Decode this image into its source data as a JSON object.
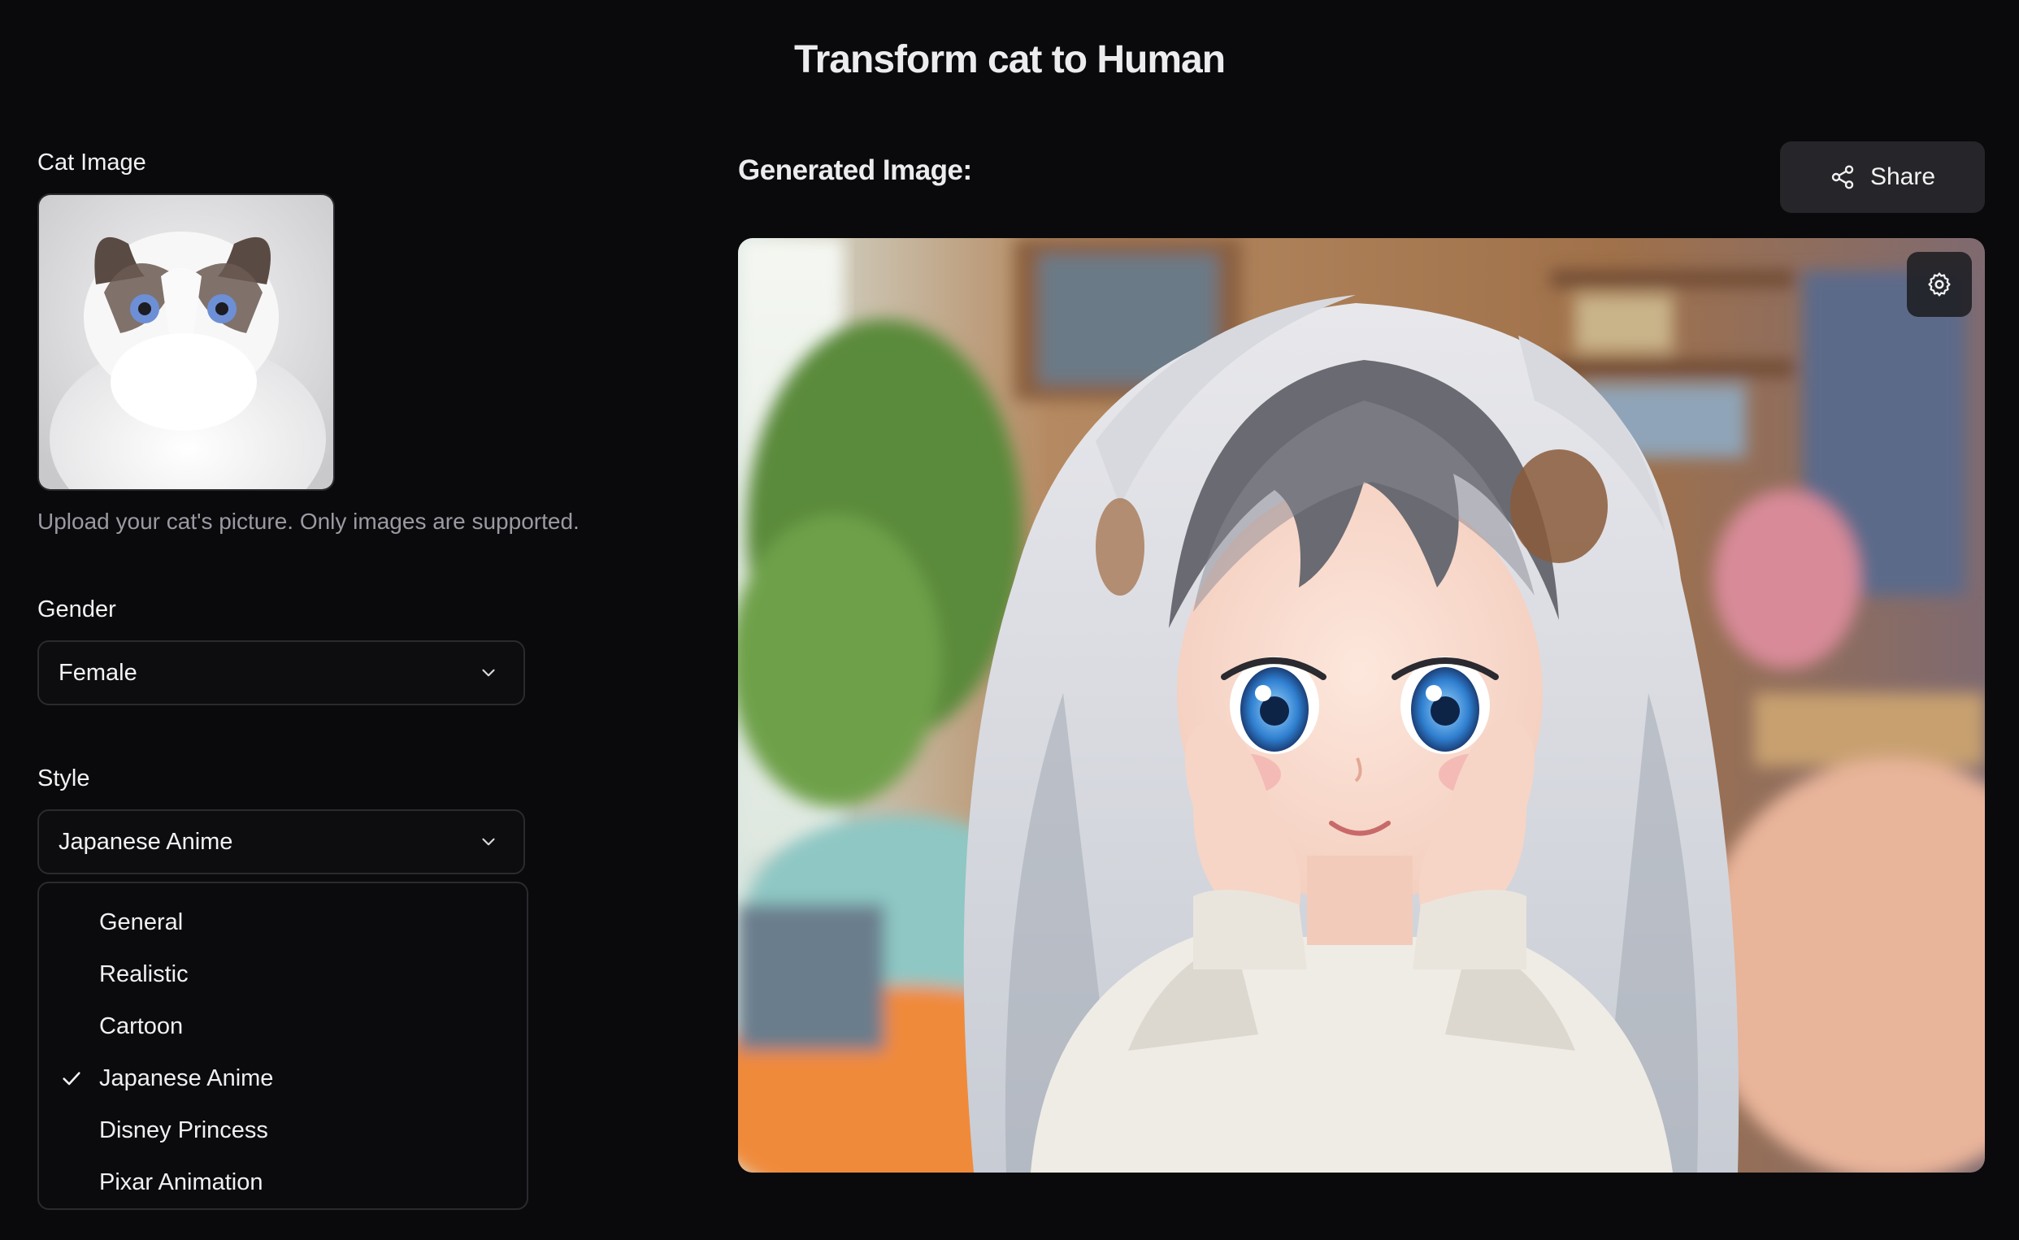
{
  "page_title": "Transform cat to Human",
  "cat_image": {
    "label": "Cat Image",
    "hint": "Upload your cat's picture. Only images are supported."
  },
  "gender": {
    "label": "Gender",
    "selected": "Female"
  },
  "style": {
    "label": "Style",
    "selected": "Japanese Anime",
    "options": [
      "General",
      "Realistic",
      "Cartoon",
      "Japanese Anime",
      "Disney Princess",
      "Pixar Animation"
    ]
  },
  "generated": {
    "label": "Generated Image:",
    "share_label": "Share"
  },
  "icons": {
    "chevron": "chevron-down-icon",
    "check": "check-icon",
    "share": "share-icon",
    "settings": "gear-icon"
  },
  "colors": {
    "background": "#0a0a0c",
    "panel_border": "#2a2a2f",
    "button_bg": "#26262a",
    "muted_text": "#9a9aa2"
  }
}
